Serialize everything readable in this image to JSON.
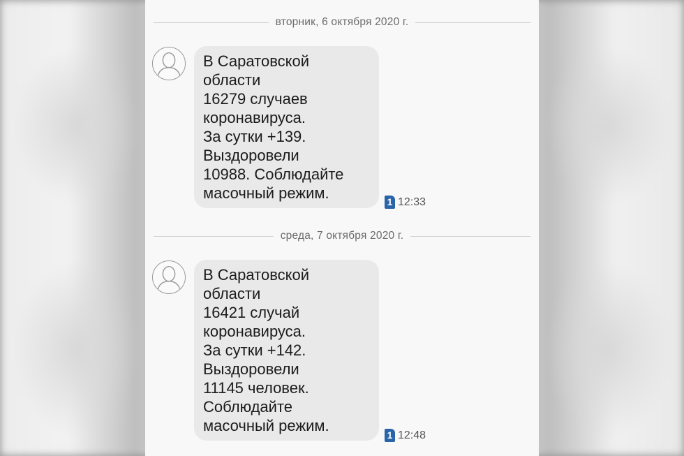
{
  "conversation": {
    "groups": [
      {
        "date": "вторник, 6 октября 2020 г.",
        "message": {
          "lines": [
            "В Саратовской",
            "области",
            "16279 случаев",
            "коронавируса.",
            "За сутки +139.",
            "Выздоровели",
            "10988. Соблюдайте",
            "масочный режим."
          ],
          "sim": "1",
          "time": "12:33"
        }
      },
      {
        "date": "среда, 7 октября 2020 г.",
        "message": {
          "lines": [
            "В Саратовской",
            "области",
            "16421 случай",
            "коронавируса.",
            "За сутки +142.",
            "Выздоровели",
            "11145 человек.",
            "Соблюдайте",
            "масочный режим."
          ],
          "sim": "1",
          "time": "12:48"
        }
      }
    ]
  },
  "icons": {
    "avatar": "person-icon",
    "sim": "sim-card-icon"
  },
  "colors": {
    "bubble": "#e9e9e9",
    "sim_badge": "#2a64a8",
    "separator": "#cfcfcf"
  }
}
